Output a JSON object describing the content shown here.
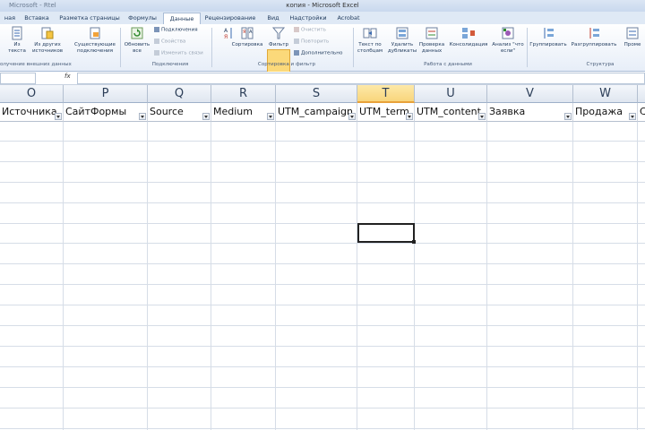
{
  "window": {
    "title": "копия - Microsoft Excel",
    "qat_label": "Microsoft - Rtel"
  },
  "ribbon_tabs": [
    {
      "label": "ная"
    },
    {
      "label": "Вставка"
    },
    {
      "label": "Разметка страницы"
    },
    {
      "label": "Формулы"
    },
    {
      "label": "Данные",
      "active": true
    },
    {
      "label": "Рецензирование"
    },
    {
      "label": "Вид"
    },
    {
      "label": "Надстройки"
    },
    {
      "label": "Acrobat"
    }
  ],
  "ribbon": {
    "groups": [
      {
        "label": "олучение внешних данных"
      },
      {
        "label": "Подключения"
      },
      {
        "label": "Сортировка и фильтр"
      },
      {
        "label": "Работа с данными"
      },
      {
        "label": "Структура"
      }
    ],
    "buttons": {
      "from_text": "Из текста",
      "from_other": "Из других источников",
      "existing": "Существующие подключения",
      "refresh": "Обновить все",
      "connections": "Подключения",
      "properties": "Свойства",
      "edit_links": "Изменить связи",
      "sort": "Сортировка",
      "filter": "Фильтр",
      "clear": "Очистить",
      "reapply": "Повторить",
      "advanced": "Дополнительно",
      "text_to_columns": "Текст по столбцам",
      "remove_duplicates": "Удалить дубликаты",
      "data_validation": "Проверка данных",
      "consolidate": "Консолидация",
      "what_if": "Анализ \"что если\"",
      "group": "Группировать",
      "ungroup": "Разгруппировать",
      "subtotal": "Проме"
    },
    "colors": {
      "filter_highlight": "#fbd97a",
      "ribbon_bg": "#e7eef8"
    }
  },
  "formula_bar": {
    "fx": "fx",
    "value": ""
  },
  "columns": [
    {
      "letter": "O",
      "header": "Источника"
    },
    {
      "letter": "P",
      "header": "СайтФормы"
    },
    {
      "letter": "Q",
      "header": "Source"
    },
    {
      "letter": "R",
      "header": "Medium"
    },
    {
      "letter": "S",
      "header": "UTM_campaign"
    },
    {
      "letter": "T",
      "header": "UTM_term",
      "selected": true
    },
    {
      "letter": "U",
      "header": "UTM_content"
    },
    {
      "letter": "V",
      "header": "Заявка"
    },
    {
      "letter": "W",
      "header": "Продажа"
    },
    {
      "letter": "",
      "header": "С"
    }
  ]
}
